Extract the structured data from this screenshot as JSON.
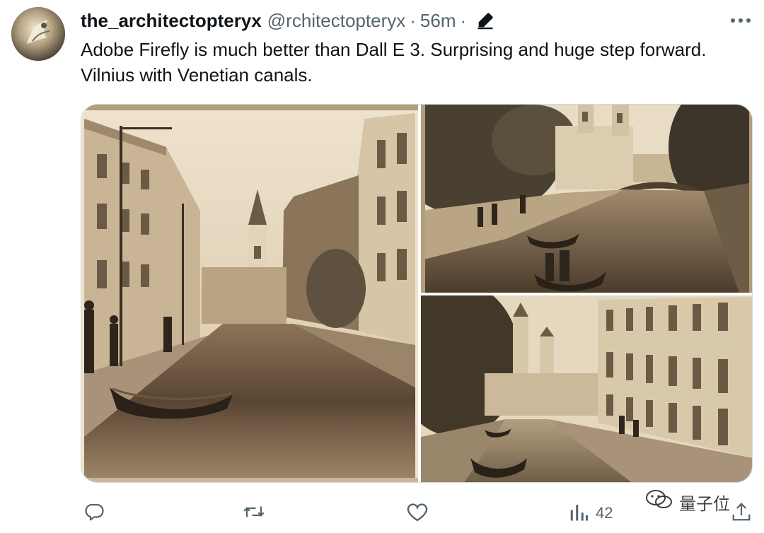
{
  "tweet": {
    "display_name": "the_architectopteryx",
    "handle": "@rchitectopteryx",
    "separator": "·",
    "time": "56m",
    "separator2": "·",
    "text": "Adobe Firefly is much better than Dall E 3. Surprising and huge step forward. Vilnius with Venetian canals."
  },
  "media": {
    "images": [
      {
        "name": "Vilnius canal street photo, sepia, boat in foreground"
      },
      {
        "name": "Canal with church towers and bridge, sepia"
      },
      {
        "name": "Canal with boats and baroque church towers, sepia"
      }
    ]
  },
  "actions": {
    "reply_icon": "reply-icon",
    "retweet_icon": "retweet-icon",
    "like_icon": "heart-icon",
    "views_icon": "analytics-icon",
    "views_count": "42",
    "share_icon": "share-icon"
  },
  "watermark": {
    "text": "量子位"
  },
  "colors": {
    "text": "#0f1419",
    "secondary": "#536471",
    "border": "#cfd9de",
    "sepia_light": "#e9dcc6",
    "sepia_dark": "#3b2f22"
  }
}
